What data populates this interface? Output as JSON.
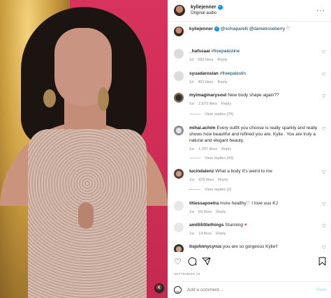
{
  "post": {
    "author": "kyliejenner",
    "audio": "Original audio",
    "date": "SEPTEMBER 28"
  },
  "caption": {
    "author": "kyliejenner",
    "mentions": "@schiaparelli @danielroseberry",
    "emoji": "♡"
  },
  "comments": [
    {
      "user": "_hafssaai",
      "text": "#freepalestine",
      "time": "1d",
      "likes": "683 likes",
      "reply": "Reply"
    },
    {
      "user": "syuadaroslan",
      "text": "#freepalestin",
      "time": "1d",
      "likes": "451 likes",
      "reply": "Reply"
    },
    {
      "user": "myimaginarysoul",
      "text": "New body shape again??",
      "time": "1w",
      "likes": "2,870 likes",
      "reply": "Reply",
      "view_replies": "View replies (25)"
    },
    {
      "user": "mihai.achim",
      "text": "Every outfit you choose is really sparkly and really shows how beautiful and refined you are. Kylie . You are truly a natural and elegant beauty.",
      "time": "1w",
      "likes": "1,097 likes",
      "reply": "Reply",
      "view_replies": "View replies (43)"
    },
    {
      "user": "lucindalenz",
      "text": "What a body It's weird to me",
      "time": "1w",
      "likes": "929 likes",
      "reply": "Reply",
      "view_replies": "View replies (2)"
    },
    {
      "user": "titiessapoetra",
      "text": "more healthy♡ I love uuu KJ",
      "time": "1w",
      "likes": "69 likes",
      "reply": "Reply"
    },
    {
      "user": "amillilittlethings",
      "text": "Stunning",
      "time": "1w",
      "likes": "19 likes",
      "reply": "Reply"
    },
    {
      "user": "itsjohnnycyrus",
      "text": "you are so gorgeous Kylie!!",
      "time": "",
      "likes": "",
      "reply": ""
    }
  ],
  "add_comment": {
    "placeholder": "Add a comment...",
    "post_label": "Post"
  },
  "icons": {
    "like": "heart-icon",
    "comment": "comment-icon",
    "share": "share-icon",
    "save": "bookmark-icon",
    "emoji": "emoji-icon",
    "more": "more-icon",
    "mute": "speaker-muted-icon"
  },
  "colors": {
    "link": "#00376b",
    "verified": "#0095f6",
    "muted_text": "#8e8e8e",
    "red_heart": "#ed4956"
  }
}
